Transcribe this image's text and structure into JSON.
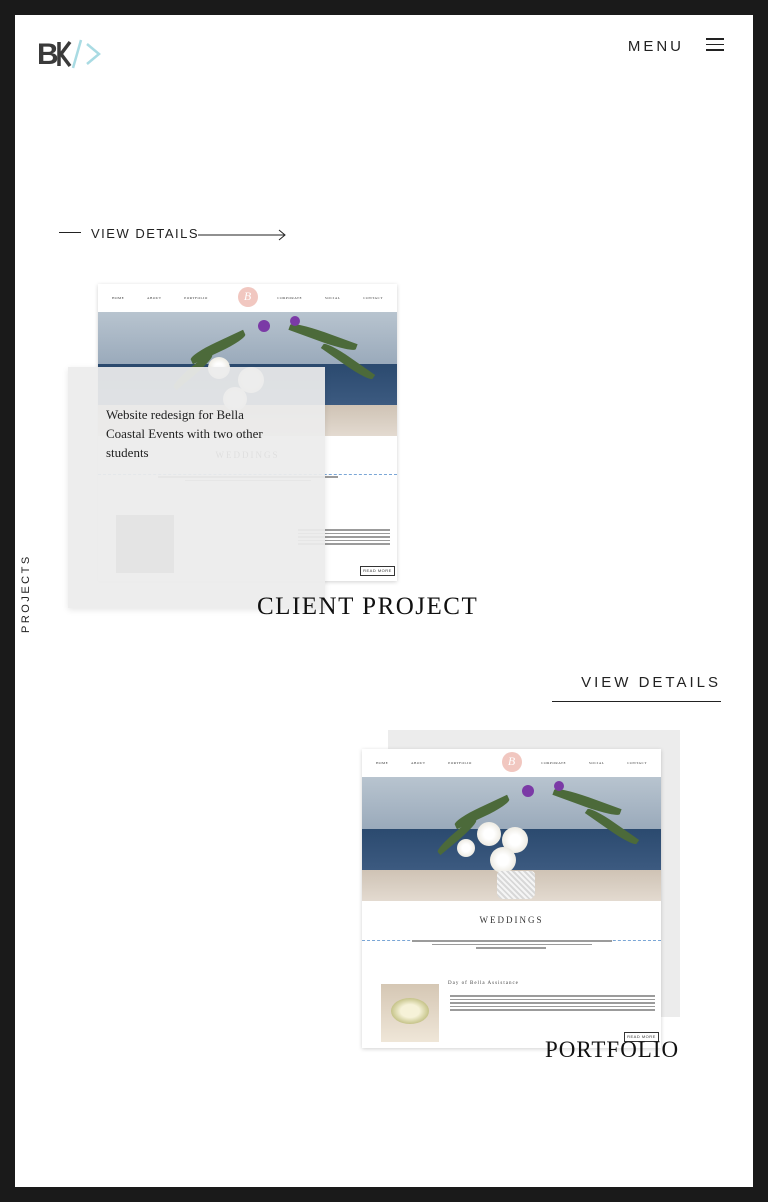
{
  "header": {
    "logo_text": "BK/>",
    "menu_label": "MENU"
  },
  "side_label": "PROJECTS",
  "projects": [
    {
      "view_details": "VIEW DETAILS",
      "title": "CLIENT PROJECT",
      "description": "Website redesign for Bella Coastal Events with two other students",
      "mock": {
        "nav": [
          "HOME",
          "ABOUT",
          "PORTFOLIO",
          "CORPORATE",
          "SOCIAL",
          "CONTACT"
        ],
        "heading": "WEDDINGS",
        "readmore": "READ MORE"
      }
    },
    {
      "view_details": "VIEW DETAILS",
      "title": "PORTFOLIO",
      "mock": {
        "nav": [
          "HOME",
          "ABOUT",
          "PORTFOLIO",
          "CORPORATE",
          "SOCIAL",
          "CONTACT"
        ],
        "heading": "WEDDINGS",
        "subheading": "Day of Bella Assistance",
        "readmore": "READ MORE"
      }
    }
  ],
  "colors": {
    "frame": "#1a1a1a",
    "logo_accent": "#a9dbe3",
    "overlay": "#ececec",
    "mock_logo": "#f1c7c0"
  }
}
